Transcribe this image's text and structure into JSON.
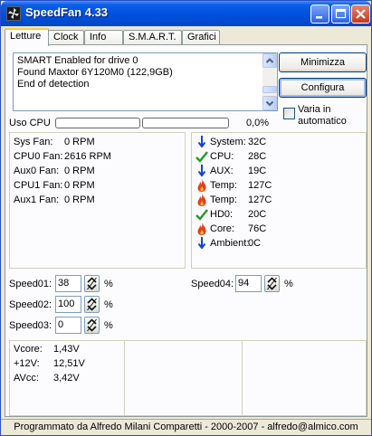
{
  "window": {
    "title": "SpeedFan 4.33"
  },
  "tabs": [
    {
      "label": "Letture",
      "active": true
    },
    {
      "label": "Clock",
      "active": false
    },
    {
      "label": "Info",
      "active": false
    },
    {
      "label": "S.M.A.R.T.",
      "active": false
    },
    {
      "label": "Grafici",
      "active": false
    }
  ],
  "log": {
    "lines": [
      "SMART Enabled for drive 0",
      "Found Maxtor 6Y120M0 (122,9GB)",
      "End of detection"
    ]
  },
  "buttons": {
    "minimize": "Minimizza",
    "configure": "Configura"
  },
  "auto_vary": {
    "label_line1": "Varia in",
    "label_line2": "automatico",
    "checked": false
  },
  "cpu_usage": {
    "label": "Uso CPU",
    "value_text": "0,0%",
    "bars": [
      0,
      0
    ]
  },
  "fans": [
    {
      "name": "Sys Fan:",
      "value": "0 RPM"
    },
    {
      "name": "CPU0 Fan:",
      "value": "2616 RPM"
    },
    {
      "name": "Aux0 Fan:",
      "value": "0 RPM"
    },
    {
      "name": "CPU1 Fan:",
      "value": "0 RPM"
    },
    {
      "name": "Aux1 Fan:",
      "value": "0 RPM"
    }
  ],
  "temps": [
    {
      "icon": "arrow-down",
      "name": "System:",
      "value": "32C"
    },
    {
      "icon": "check",
      "name": "CPU:",
      "value": "28C"
    },
    {
      "icon": "arrow-down",
      "name": "AUX:",
      "value": "19C"
    },
    {
      "icon": "flame",
      "name": "Temp:",
      "value": "127C"
    },
    {
      "icon": "flame",
      "name": "Temp:",
      "value": "127C"
    },
    {
      "icon": "check",
      "name": "HD0:",
      "value": "20C"
    },
    {
      "icon": "flame",
      "name": "Core:",
      "value": "76C"
    },
    {
      "icon": "arrow-down",
      "name": "Ambient:",
      "value": "0C"
    }
  ],
  "speeds": [
    {
      "label": "Speed01:",
      "value": "38",
      "unit": "%"
    },
    {
      "label": "Speed02:",
      "value": "100",
      "unit": "%"
    },
    {
      "label": "Speed03:",
      "value": "0",
      "unit": "%"
    },
    {
      "label": "Speed04:",
      "value": "94",
      "unit": "%"
    }
  ],
  "voltages": [
    {
      "name": "Vcore:",
      "value": "1,43V"
    },
    {
      "name": "+12V:",
      "value": "12,51V"
    },
    {
      "name": "AVcc:",
      "value": "3,42V"
    }
  ],
  "statusbar": {
    "text": "Programmato da Alfredo Milani Comparetti - 2000-2007 - alfredo@almico.com"
  },
  "colors": {
    "title_bar": "#0050dd",
    "arrow_blue": "#1a3fd6",
    "check_green": "#1e9a2a",
    "flame_red": "#e2401c",
    "tab_highlight": "#ffc83c"
  }
}
